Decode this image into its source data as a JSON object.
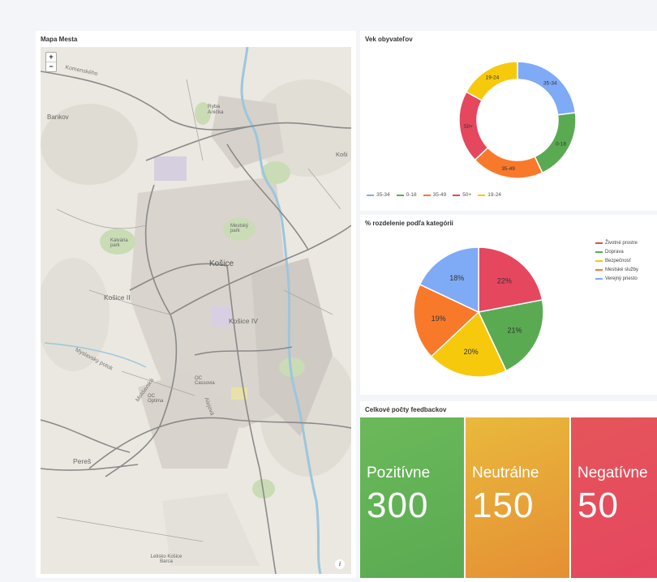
{
  "colors": {
    "blue": "#7faaf5",
    "green": "#5aaa52",
    "orange": "#f9792b",
    "red": "#e5475f",
    "yellow": "#f6c90c"
  },
  "map": {
    "title": "Mapa Mesta",
    "zoom_in": "+",
    "zoom_out": "−",
    "info": "i",
    "labels": {
      "city": "Košice",
      "district_iv": "Košice IV",
      "district_ii": "Košice II",
      "bankov": "Bankov",
      "peres": "Pereš",
      "kosice_right": "Koši",
      "rybe": "Ryba Anička",
      "kalvaria": "Kalvária park",
      "mestsky_park": "Mestský park",
      "oc": "OC Cassovia",
      "optima": "OC Optima",
      "letisko": "Letisko Košice Barca",
      "road_komenskeho": "Komenského",
      "road_moldavska": "Moldavská",
      "road_alejova": "Alejová",
      "road_myslava": "Myslavský potok"
    }
  },
  "age_chart": {
    "title": "Vek obyvateľov",
    "chart_data": {
      "type": "pie",
      "variant": "donut",
      "categories": [
        "35-34",
        "0-18",
        "35-49",
        "50+",
        "19-24"
      ],
      "values": [
        23,
        20,
        20,
        20,
        17
      ],
      "colors": [
        "#7faaf5",
        "#5aaa52",
        "#f9792b",
        "#e5475f",
        "#f6c90c"
      ],
      "legend_position": "bottom"
    }
  },
  "category_chart": {
    "title": "% rozdelenie podľa kategórii",
    "chart_data": {
      "type": "pie",
      "categories": [
        "Životné prostre",
        "Doprava",
        "Bezpečnosť",
        "Mestské služby",
        "Verejný priesto"
      ],
      "values": [
        22,
        21,
        20,
        19,
        18
      ],
      "data_labels": [
        "22%",
        "21%",
        "20%",
        "19%",
        "18%"
      ],
      "colors": [
        "#e5475f",
        "#5aaa52",
        "#f6c90c",
        "#f9792b",
        "#7faaf5"
      ],
      "legend_position": "right"
    }
  },
  "feedback": {
    "title": "Celkové počty feedbackov",
    "cards": [
      {
        "label": "Pozitívne",
        "value": "300",
        "color_from": "#6bb95a",
        "color_to": "#5aaa52"
      },
      {
        "label": "Neutrálne",
        "value": "150",
        "color_from": "#e9b93c",
        "color_to": "#e58f34"
      },
      {
        "label": "Negatívne",
        "value": "50",
        "color_from": "#e5555a",
        "color_to": "#e5475f"
      }
    ]
  }
}
